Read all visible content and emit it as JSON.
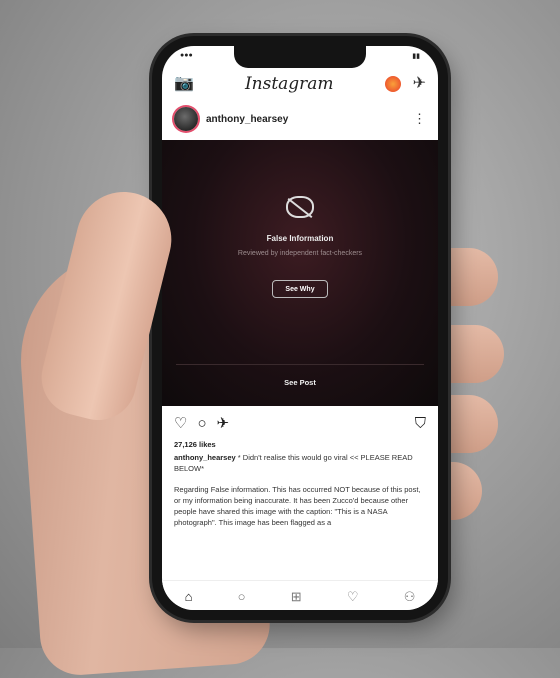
{
  "app": {
    "logo": "Instagram"
  },
  "post": {
    "username": "anthony_hearsey",
    "warning": {
      "title": "False Information",
      "subtitle": "Reviewed by independent fact-checkers",
      "see_why": "See Why",
      "see_post": "See Post"
    },
    "likes": "27,126 likes",
    "caption_user": "anthony_hearsey",
    "caption_text": "* Didn't realise this would go viral << PLEASE READ BELOW*",
    "caption_body": "Regarding False information. This has occurred NOT because of this post, or my information being inaccurate. It has been Zucco'd because other people have shared this image with the caption: \"This is a NASA photograph\". This image has been flagged as a"
  },
  "icons": {
    "camera": "📷",
    "dm": "✈",
    "more": "⋮",
    "heart": "♡",
    "comment": "○",
    "share": "✈",
    "bookmark": "⛉",
    "home": "⌂",
    "search": "○",
    "add": "⊞",
    "activity": "♡",
    "profile": "⚇"
  },
  "colors": {
    "story_ring": "#e34f6d",
    "warning_bg": "#1c0f13"
  }
}
